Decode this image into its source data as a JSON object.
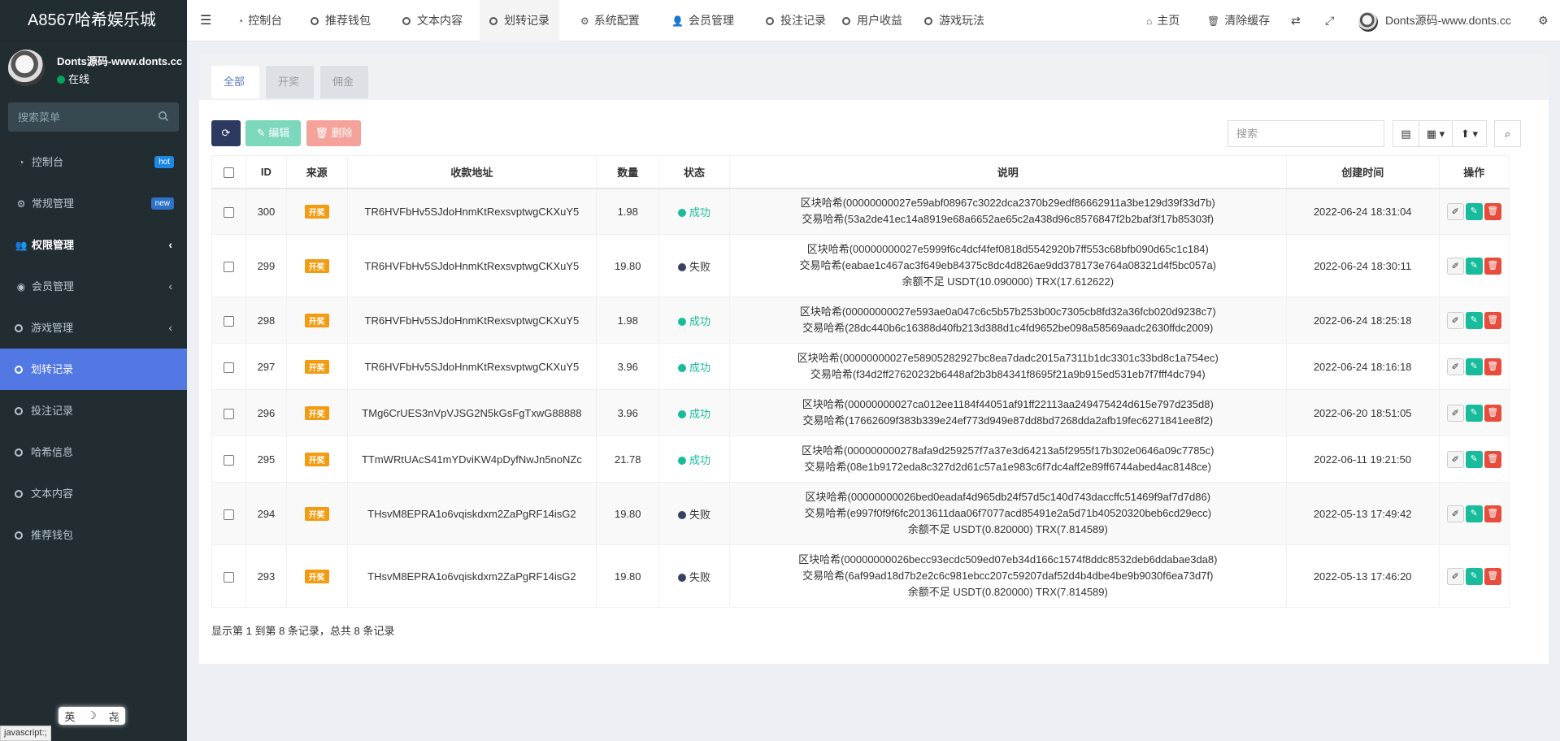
{
  "sidebar": {
    "logo": "A8567哈希娱乐城",
    "user_name": "Donts源码-www.donts.cc",
    "user_status": "在线",
    "search_placeholder": "搜索菜单",
    "items": [
      {
        "label": "控制台",
        "icon": "dashboard-icon",
        "badge": "hot"
      },
      {
        "label": "常规管理",
        "icon": "cogs-icon",
        "badge": "new"
      },
      {
        "label": "权限管理",
        "icon": "group-icon",
        "chevron": true
      },
      {
        "label": "会员管理",
        "icon": "user-circle-icon",
        "chevron": true
      },
      {
        "label": "游戏管理",
        "icon": "circle-icon",
        "chevron": true
      },
      {
        "label": "划转记录",
        "icon": "circle-icon",
        "active": true
      },
      {
        "label": "投注记录",
        "icon": "circle-icon"
      },
      {
        "label": "哈希信息",
        "icon": "circle-icon"
      },
      {
        "label": "文本内容",
        "icon": "circle-icon"
      },
      {
        "label": "推荐钱包",
        "icon": "circle-icon"
      }
    ]
  },
  "ime": {
    "lang": "英",
    "moon": "☽",
    "mode": "㐂"
  },
  "statusbar": "javascript:;",
  "topbar": {
    "tabs": [
      "控制台",
      "推荐钱包",
      "文本内容",
      "划转记录",
      "系统配置",
      "会员管理",
      "投注记录",
      "用户收益",
      "游戏玩法"
    ],
    "home": "主页",
    "clear_cache": "清除缓存",
    "user": "Donts源码-www.donts.cc"
  },
  "content": {
    "tabs": [
      "全部",
      "开奖",
      "佣金"
    ],
    "edit_label": "编辑",
    "delete_label": "删除",
    "search_placeholder": "搜索",
    "columns": [
      "ID",
      "来源",
      "收款地址",
      "数量",
      "状态",
      "说明",
      "创建时间",
      "操作"
    ],
    "rows": [
      {
        "id": "300",
        "source": "开奖",
        "address": "TR6HVFbHv5SJdoHnmKtRexsvptwgCKXuY5",
        "amount": "1.98",
        "status": "成功",
        "ok": true,
        "desc": [
          "区块哈希(00000000027e59abf08967c3022dca2370b29edf86662911a3be129d39f33d7b)",
          "交易哈希(53a2de41ec14a8919e68a6652ae65c2a438d96c8576847f2b2baf3f17b85303f)"
        ],
        "time": "2022-06-24 18:31:04"
      },
      {
        "id": "299",
        "source": "开奖",
        "address": "TR6HVFbHv5SJdoHnmKtRexsvptwgCKXuY5",
        "amount": "19.80",
        "status": "失败",
        "ok": false,
        "desc": [
          "区块哈希(00000000027e5999f6c4dcf4fef0818d5542920b7ff553c68bfb090d65c1c184)",
          "交易哈希(eabae1c467ac3f649eb84375c8dc4d826ae9dd378173e764a08321d4f5bc057a)",
          "余额不足 USDT(10.090000) TRX(17.612622)"
        ],
        "time": "2022-06-24 18:30:11"
      },
      {
        "id": "298",
        "source": "开奖",
        "address": "TR6HVFbHv5SJdoHnmKtRexsvptwgCKXuY5",
        "amount": "1.98",
        "status": "成功",
        "ok": true,
        "desc": [
          "区块哈希(00000000027e593ae0a047c6c5b57b253b00c7305cb8fd32a36fcb020d9238c7)",
          "交易哈希(28dc440b6c16388d40fb213d388d1c4fd9652be098a58569aadc2630ffdc2009)"
        ],
        "time": "2022-06-24 18:25:18"
      },
      {
        "id": "297",
        "source": "开奖",
        "address": "TR6HVFbHv5SJdoHnmKtRexsvptwgCKXuY5",
        "amount": "3.96",
        "status": "成功",
        "ok": true,
        "desc": [
          "区块哈希(00000000027e58905282927bc8ea7dadc2015a7311b1dc3301c33bd8c1a754ec)",
          "交易哈希(f34d2ff27620232b6448af2b3b84341f8695f21a9b915ed531eb7f7fff4dc794)"
        ],
        "time": "2022-06-24 18:16:18"
      },
      {
        "id": "296",
        "source": "开奖",
        "address": "TMg6CrUES3nVpVJSG2N5kGsFgTxwG88888",
        "amount": "3.96",
        "status": "成功",
        "ok": true,
        "desc": [
          "区块哈希(00000000027ca012ee1184f44051af91ff22113aa249475424d615e797d235d8)",
          "交易哈希(17662609f383b339e24ef773d949e87dd8bd7268dda2afb19fec6271841ee8f2)"
        ],
        "time": "2022-06-20 18:51:05"
      },
      {
        "id": "295",
        "source": "开奖",
        "address": "TTmWRtUAcS41mYDviKW4pDyfNwJn5noNZc",
        "amount": "21.78",
        "status": "成功",
        "ok": true,
        "desc": [
          "区块哈希(000000000278afa9d259257f7a37e3d64213a5f2955f17b302e0646a09c7785c)",
          "交易哈希(08e1b9172eda8c327d2d61c57a1e983c6f7dc4aff2e89ff6744abed4ac8148ce)"
        ],
        "time": "2022-06-11 19:21:50"
      },
      {
        "id": "294",
        "source": "开奖",
        "address": "THsvM8EPRA1o6vqiskdxm2ZaPgRF14isG2",
        "amount": "19.80",
        "status": "失败",
        "ok": false,
        "desc": [
          "区块哈希(00000000026bed0eadaf4d965db24f57d5c140d743daccffc51469f9af7d7d86)",
          "交易哈希(e997f0f9f6fc2013611daa06f7077acd85491e2a5d71b40520320beb6cd29ecc)",
          "余额不足 USDT(0.820000) TRX(7.814589)"
        ],
        "time": "2022-05-13 17:49:42"
      },
      {
        "id": "293",
        "source": "开奖",
        "address": "THsvM8EPRA1o6vqiskdxm2ZaPgRF14isG2",
        "amount": "19.80",
        "status": "失败",
        "ok": false,
        "desc": [
          "区块哈希(00000000026becc93ecdc509ed07eb34d166c1574f8ddc8532deb6ddabae3da8)",
          "交易哈希(6af99ad18d7b2e2c6c981ebcc207c59207daf52d4b4dbe4be9b9030f6ea73d7f)",
          "余额不足 USDT(0.820000) TRX(7.814589)"
        ],
        "time": "2022-05-13 17:46:20"
      }
    ],
    "pager_text": "显示第 1 到第 8 条记录，总共 8 条记录"
  },
  "colors": {
    "sidebar_bg": "#222d32",
    "active_menu": "#5278e4",
    "success": "#18bc9c",
    "danger": "#e74c3c",
    "tag": "#f39c12"
  }
}
